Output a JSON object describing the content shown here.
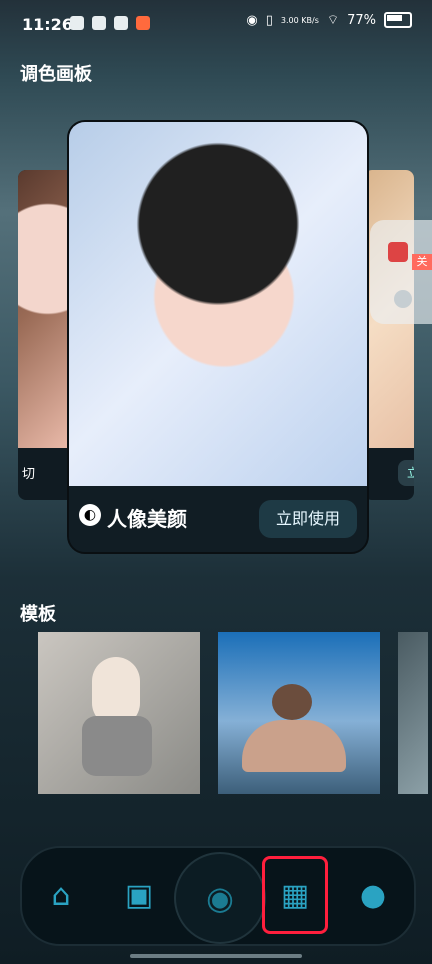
{
  "status": {
    "time": "11:26",
    "network_speed": "3.00\nKB/s",
    "battery": "77%"
  },
  "palette": {
    "title": "调色画板"
  },
  "cards": {
    "left_caption": "切",
    "main_label": "人像美颜",
    "main_button": "立即使用",
    "right_button": "立"
  },
  "floating": {
    "badge_text": "关"
  },
  "templates": {
    "title": "模板"
  },
  "nav": {
    "home_icon": "home-icon",
    "gallery_icon": "gallery-icon",
    "camera_icon": "camera-icon",
    "templates_icon": "templates-icon",
    "profile_icon": "profile-icon"
  }
}
